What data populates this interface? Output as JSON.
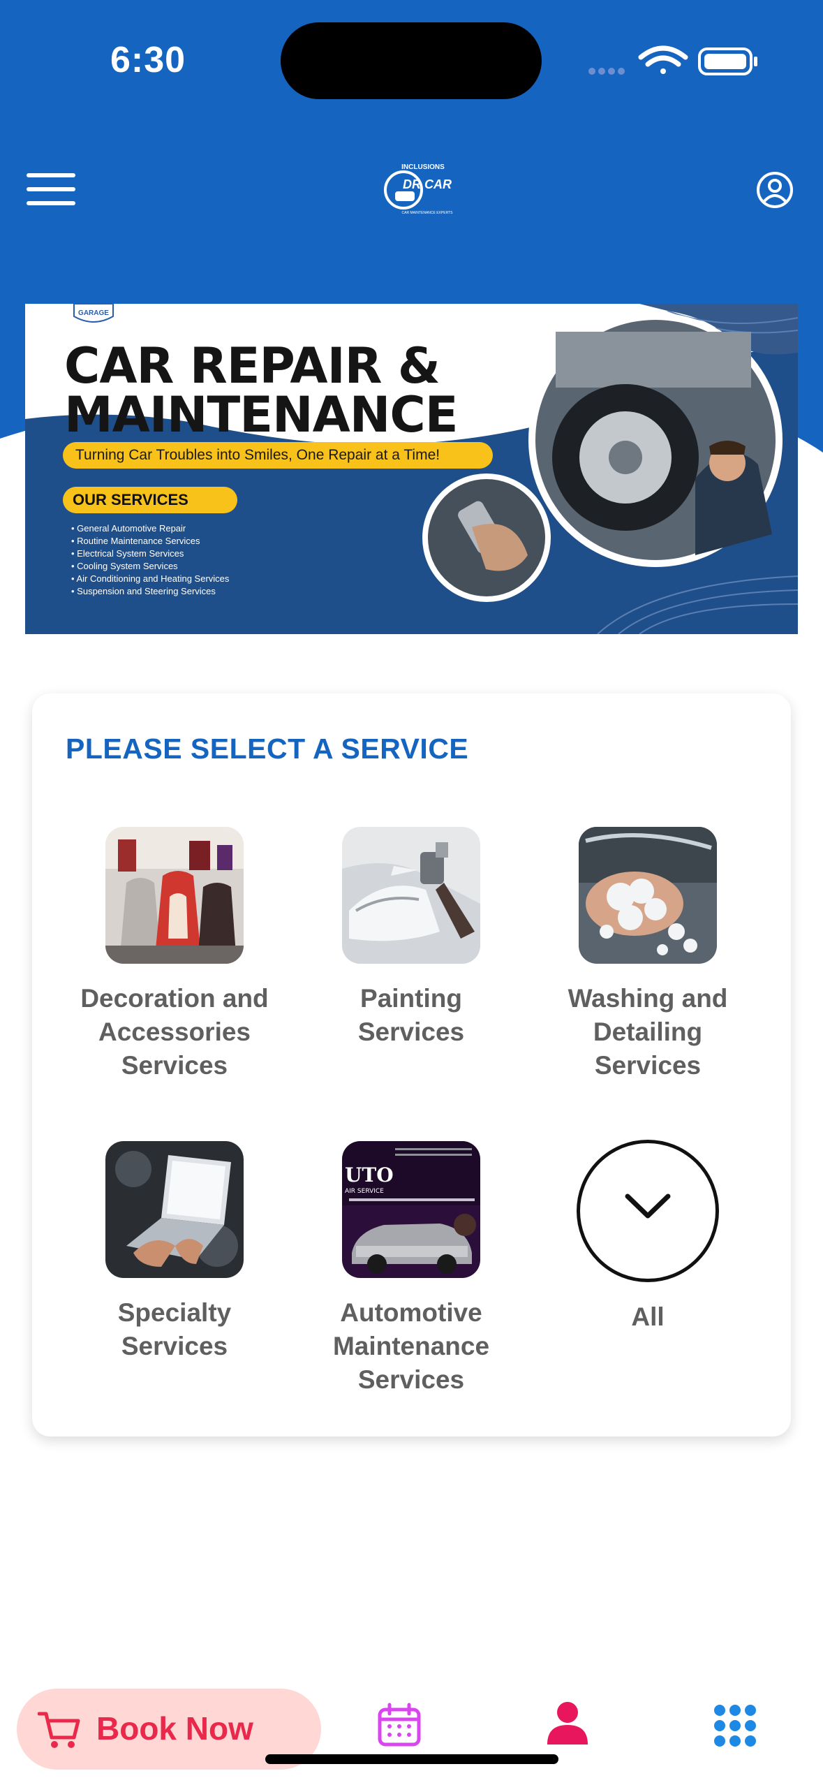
{
  "status_bar": {
    "time": "6:30"
  },
  "header": {
    "logo_top": "INCLUSIONS",
    "logo_main": "DR CAR",
    "logo_sub": "CAR MAINTENANCE EXPERTS"
  },
  "banner": {
    "badge": "GARAGE",
    "title_line1": "CAR REPAIR &",
    "title_line2": "MAINTENANCE",
    "tagline": "Turning Car Troubles into Smiles, One Repair at a Time!",
    "services_heading": "OUR SERVICES",
    "services": [
      "General Automotive Repair",
      "Routine Maintenance Services",
      "Electrical System Services",
      "Cooling System Services",
      "Air Conditioning and Heating Services",
      "Suspension and Steering Services"
    ]
  },
  "service_picker": {
    "title": "PLEASE SELECT A SERVICE",
    "tiles": [
      {
        "label": "Decoration and Accessories Services"
      },
      {
        "label": "Painting Services"
      },
      {
        "label": "Washing and Detailing Services"
      },
      {
        "label": "Specialty Services"
      },
      {
        "label": "Automotive Maintenance Services",
        "image_text": "UTO",
        "image_subtext": "AIR SERVICE"
      },
      {
        "label": "All"
      }
    ]
  },
  "bottom_bar": {
    "book_label": "Book Now"
  },
  "colors": {
    "primary": "#1565c0",
    "accent": "#e8294b",
    "book_bg": "#ffd7d4",
    "calendar": "#d946ef",
    "grid": "#1e88e5"
  }
}
